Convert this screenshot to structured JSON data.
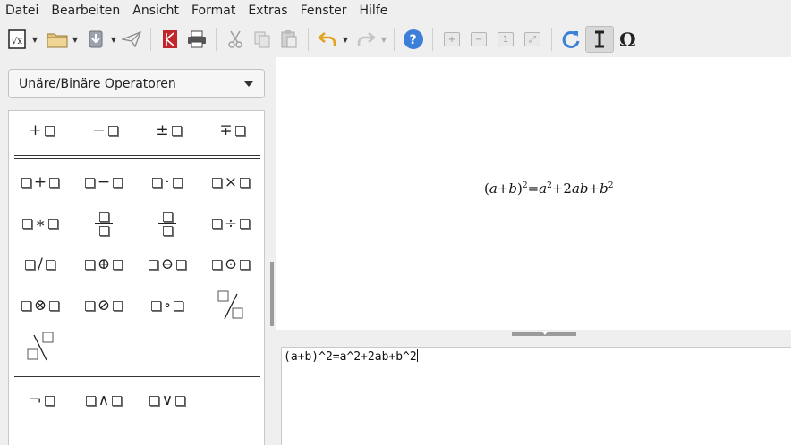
{
  "menubar": {
    "items": [
      "Datei",
      "Bearbeiten",
      "Ansicht",
      "Format",
      "Extras",
      "Fenster",
      "Hilfe"
    ]
  },
  "toolbar": {
    "icons": [
      "formula-doc-icon",
      "open-folder-icon",
      "save-icon",
      "send-icon",
      "pdf-export-icon",
      "print-icon",
      "cut-icon",
      "copy-icon",
      "paste-icon",
      "undo-icon",
      "redo-icon",
      "help-icon",
      "zoom-in-icon",
      "zoom-out-icon",
      "zoom-100-icon",
      "show-all-icon",
      "update-icon",
      "formula-cursor-icon",
      "symbols-icon"
    ],
    "accent": "#3b7fd9"
  },
  "sidebar": {
    "category": "Unäre/Binäre Operatoren",
    "unary": [
      "+",
      "−",
      "±",
      "∓"
    ],
    "binary": [
      [
        "+",
        "−",
        "·",
        "×"
      ],
      [
        "∗",
        "",
        "",
        "÷"
      ],
      [
        "/",
        "⊕",
        "⊖",
        "⊙"
      ],
      [
        "⊗",
        "⊘",
        "∘",
        ""
      ]
    ],
    "logic": [
      "¬",
      "∧",
      "∨"
    ]
  },
  "preview": {
    "formula_text": "(a+b)²=a²+2ab+b²"
  },
  "editor": {
    "command": "(a+b)^2=a^2+2ab+b^2"
  }
}
